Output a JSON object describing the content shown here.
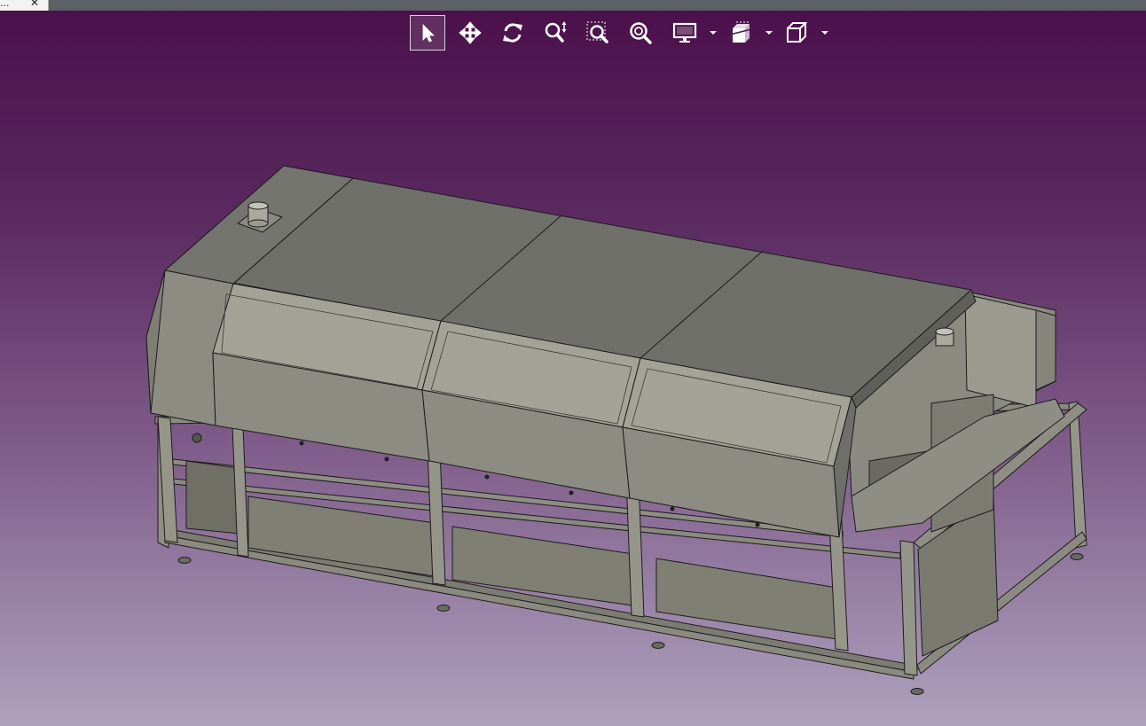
{
  "window": {
    "tab_label": "...",
    "tab_close": "✕"
  },
  "toolbar": {
    "tools": [
      {
        "name": "select-tool",
        "icon": "cursor-arrow-icon",
        "active": true
      },
      {
        "name": "pan-tool",
        "icon": "four-way-move-icon",
        "active": false
      },
      {
        "name": "rotate-tool",
        "icon": "rotate-arrows-icon",
        "active": false
      },
      {
        "name": "zoom-tool",
        "icon": "zoom-updown-icon",
        "active": false
      },
      {
        "name": "zoom-window-tool",
        "icon": "zoom-window-icon",
        "active": false
      },
      {
        "name": "zoom-fit-tool",
        "icon": "zoom-fit-icon",
        "active": false
      },
      {
        "name": "display-mode-dropdown",
        "icon": "monitor-icon",
        "active": false
      },
      {
        "name": "section-view-dropdown",
        "icon": "section-cut-icon",
        "active": false
      },
      {
        "name": "standard-view-dropdown",
        "icon": "iso-cube-icon",
        "active": false
      }
    ]
  },
  "viewport": {
    "background_top": "#4a0f4a",
    "background_bottom": "#ada1bd",
    "model_fill_light": "#a0a094",
    "model_fill_mid": "#7f7f74",
    "model_fill_dark": "#6d6e67",
    "model_edge": "#1c1c1c",
    "model_description_icon": "reflow-oven-3d-model"
  }
}
